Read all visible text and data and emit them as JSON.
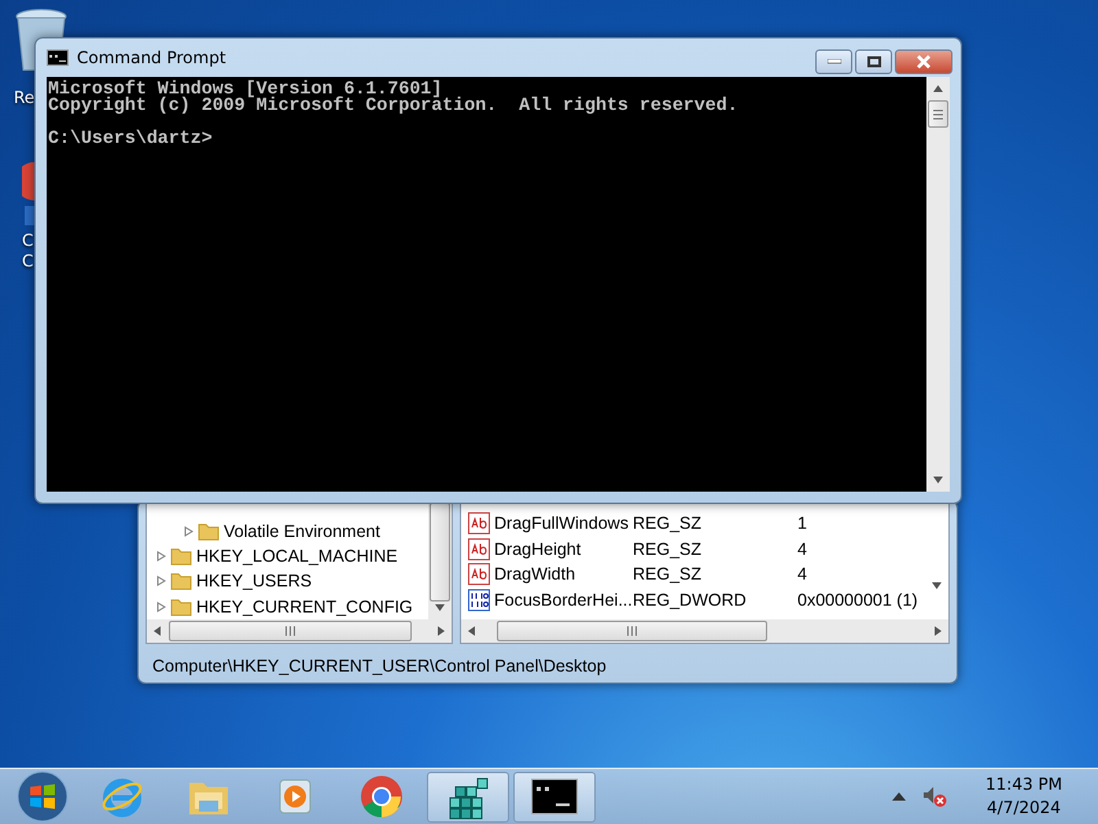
{
  "desktop_icons": [
    {
      "kind": "bin",
      "lines": [
        "Re"
      ]
    },
    {
      "kind": "browser",
      "lines": [
        "C",
        "C"
      ]
    }
  ],
  "registry_window": {
    "tree": [
      {
        "children": [
          {
            "label": "Volatile Environment",
            "expanded": false
          }
        ]
      },
      {
        "label": "HKEY_LOCAL_MACHINE",
        "expanded": false
      },
      {
        "label": "HKEY_USERS",
        "expanded": false
      },
      {
        "label": "HKEY_CURRENT_CONFIG",
        "expanded": false
      }
    ],
    "values": [
      {
        "kind": "string",
        "name": "DragFullWindows",
        "type": "REG_SZ",
        "data": "1"
      },
      {
        "kind": "string",
        "name": "DragHeight",
        "type": "REG_SZ",
        "data": "4"
      },
      {
        "kind": "string",
        "name": "DragWidth",
        "type": "REG_SZ",
        "data": "4"
      },
      {
        "kind": "binary",
        "name": "FocusBorderHei...",
        "type": "REG_DWORD",
        "data": "0x00000001 (1)"
      }
    ],
    "status_bar": "Computer\\HKEY_CURRENT_USER\\Control Panel\\Desktop"
  },
  "cmd_window": {
    "title": "Command Prompt",
    "blocks": [
      [
        "Microsoft Windows [Version 6.1.7601]",
        "Copyright (c) 2009 Microsoft Corporation.  All rights reserved."
      ],
      [
        "C:\\Users\\dartz>"
      ]
    ]
  },
  "taskbar": {
    "items": [
      {
        "kind": "ie",
        "open": false
      },
      {
        "kind": "folder",
        "open": false
      },
      {
        "kind": "media",
        "open": false
      },
      {
        "kind": "chrome",
        "open": false
      },
      {
        "kind": "regedit",
        "open": true
      },
      {
        "kind": "cmd",
        "open": true
      }
    ],
    "time": "11:43 PM",
    "date": "4/7/2024"
  }
}
